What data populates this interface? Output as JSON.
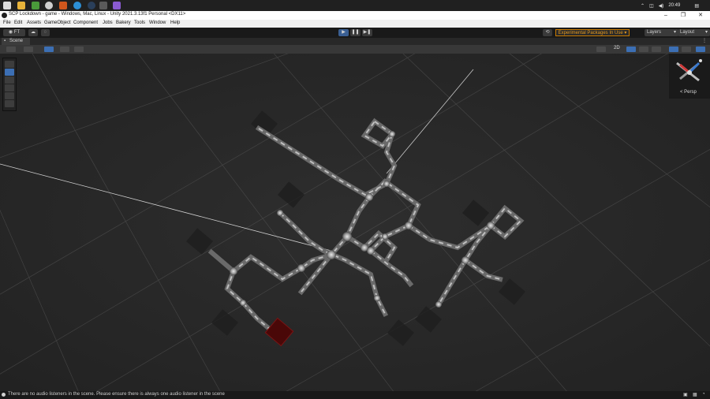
{
  "taskbar": {
    "icons": [
      "windows-icon",
      "file-explorer-icon",
      "app-green-icon",
      "unity-hub-icon",
      "app-orange-icon",
      "edge-icon",
      "steam-icon",
      "unity-icon",
      "visual-studio-icon"
    ],
    "clock": "20:49"
  },
  "window": {
    "title": "SCP Lockdown - game - Windows, Mac, Linux - Unity 2021.3.13f1 Personal <DX11>",
    "minimize": "–",
    "maximize": "❐",
    "close": "✕"
  },
  "menu": {
    "items": [
      "File",
      "Edit",
      "Assets",
      "GameObject",
      "Component",
      "Jobs",
      "Bakery",
      "Tools",
      "Window",
      "Help"
    ]
  },
  "toolbar": {
    "account": "FT",
    "play_icon": "▶",
    "pause_icon": "❚❚",
    "step_icon": "▶❚",
    "experimental": "Experimental Packages In Use ▾",
    "layers": "Layers",
    "layout": "Layout"
  },
  "scene": {
    "tab_label": "Scene",
    "mode_2d": "2D",
    "persp_label": "< Persp"
  },
  "status": {
    "message": "There are no audio listeners in the scene. Please ensure there is always one audio listener in the scene"
  },
  "colors": {
    "play_active": "#3a5f93",
    "experimental_border": "#c97a00",
    "selected_room": "#5a0a0a"
  }
}
